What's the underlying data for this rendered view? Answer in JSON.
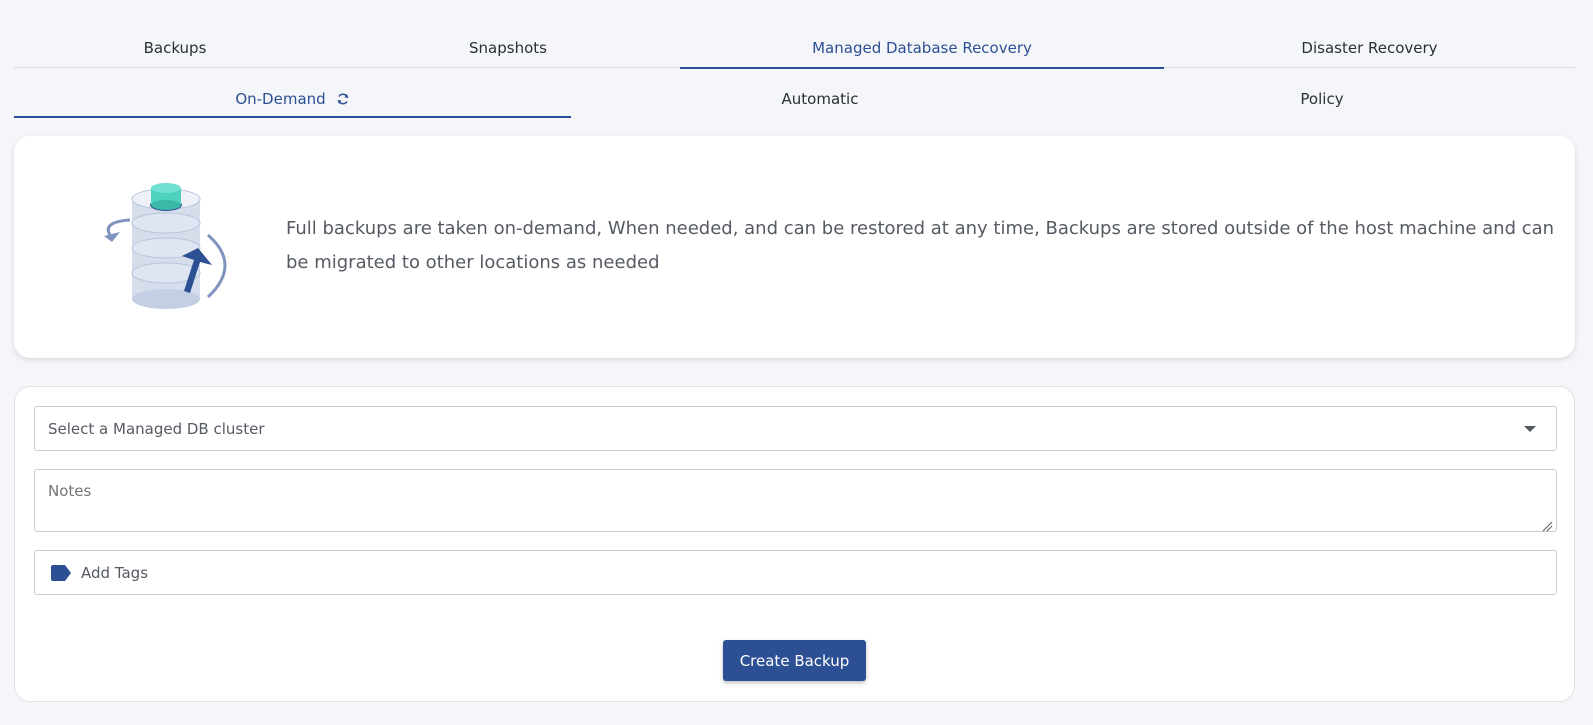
{
  "top_tabs": [
    {
      "label": "Backups"
    },
    {
      "label": "Snapshots"
    },
    {
      "label": "Managed Database Recovery"
    },
    {
      "label": "Disaster Recovery"
    }
  ],
  "sub_tabs": [
    {
      "label": "On-Demand",
      "icon": "refresh-icon"
    },
    {
      "label": "Automatic"
    },
    {
      "label": "Policy"
    }
  ],
  "info": {
    "illustration": "database-backup-illustration",
    "text": "Full backups are taken on-demand, When needed, and can be restored at any time, Backups are stored outside of the host machine and can be migrated to other locations as needed"
  },
  "form": {
    "cluster_select": {
      "placeholder": "Select a Managed DB cluster"
    },
    "notes": {
      "placeholder": "Notes"
    },
    "tags": {
      "placeholder": "Add Tags",
      "icon": "tag-icon"
    },
    "submit_label": "Create Backup"
  },
  "colors": {
    "accent": "#2d4f94",
    "page_background": "#f4f6f9",
    "card_background": "#ffffff"
  }
}
